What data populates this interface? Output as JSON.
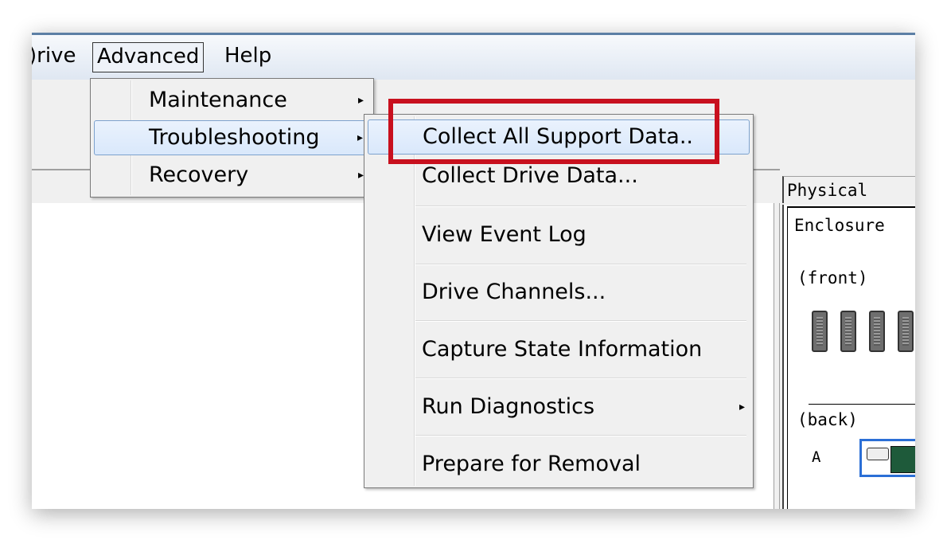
{
  "menubar": {
    "drive": ")rive",
    "advanced": "Advanced",
    "help": "Help"
  },
  "advanced_menu": {
    "items": [
      {
        "label": "Maintenance",
        "has_submenu": true
      },
      {
        "label": "Troubleshooting",
        "has_submenu": true,
        "highlighted": true
      },
      {
        "label": "Recovery",
        "has_submenu": true
      }
    ]
  },
  "troubleshooting_menu": {
    "items": [
      {
        "label": "Collect All Support Data..",
        "highlighted": true
      },
      {
        "label": "Collect Drive Data..."
      },
      {
        "label": "View Event Log"
      },
      {
        "label": "Drive Channels..."
      },
      {
        "label": "Capture State Information"
      },
      {
        "label": "Run Diagnostics",
        "has_submenu": true
      },
      {
        "label": "Prepare for Removal"
      }
    ]
  },
  "physical_panel": {
    "tab": "Physical",
    "enclosure": "Enclosure",
    "front": "(front)",
    "back": "(back)",
    "controller_a": "A"
  },
  "annotation": {
    "color": "#c8101e"
  },
  "icons": {
    "submenu_arrow": "▸"
  }
}
